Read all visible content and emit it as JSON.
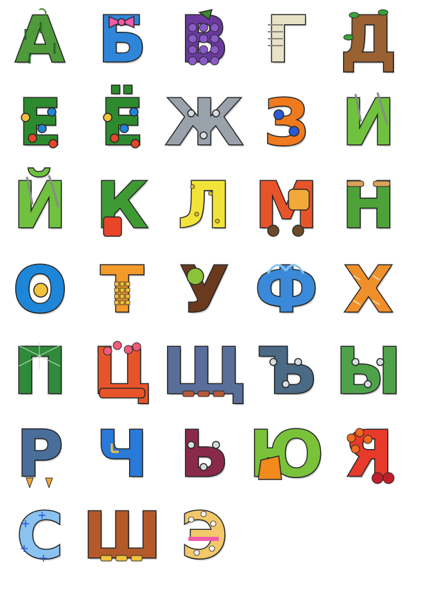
{
  "letters": [
    {
      "char": "А",
      "fill": "#4f9a3a",
      "deco": "melon"
    },
    {
      "char": "Б",
      "fill": "#2f86d9",
      "deco": "bow",
      "accent": "#f25ba7"
    },
    {
      "char": "В",
      "fill": "#6a3a9e",
      "deco": "grapes",
      "accent": "#3a8a2a"
    },
    {
      "char": "Г",
      "fill": "#e8e2c8",
      "deco": "newspaper"
    },
    {
      "char": "Д",
      "fill": "#9a6232",
      "deco": "tree",
      "accent": "#3aa23a"
    },
    {
      "char": "Е",
      "fill": "#2e8a2e",
      "deco": "ornaments"
    },
    {
      "char": "Ё",
      "fill": "#2e8a2e",
      "deco": "ornaments"
    },
    {
      "char": "Ж",
      "fill": "#9aa2ab",
      "deco": "bolts"
    },
    {
      "char": "З",
      "fill": "#f07a1e",
      "deco": "patch",
      "accent": "#2a5ad9"
    },
    {
      "char": "И",
      "fill": "#6fc13f",
      "deco": "needles"
    },
    {
      "char": "Й",
      "fill": "#6fc13f",
      "deco": "needles"
    },
    {
      "char": "К",
      "fill": "#3f9a34",
      "deco": "cactus",
      "accent": "#e8452a"
    },
    {
      "char": "Л",
      "fill": "#f2e33a",
      "deco": "noodle"
    },
    {
      "char": "М",
      "fill": "#e8542a",
      "deco": "truck",
      "accent": "#f2a93a"
    },
    {
      "char": "Н",
      "fill": "#4fa23a",
      "deco": "spools"
    },
    {
      "char": "О",
      "fill": "#1e86d9",
      "deco": "pond",
      "accent": "#f2c23a"
    },
    {
      "char": "Т",
      "fill": "#f29a2a",
      "deco": "phone"
    },
    {
      "char": "У",
      "fill": "#6a3a1e",
      "deco": "snail",
      "accent": "#8ac23a"
    },
    {
      "char": "Ф",
      "fill": "#3a8ad9",
      "deco": "fountain"
    },
    {
      "char": "Х",
      "fill": "#f0902a",
      "deco": "bread"
    },
    {
      "char": "П",
      "fill": "#2f8a3a",
      "deco": "web"
    },
    {
      "char": "Ц",
      "fill": "#e8542a",
      "deco": "flowers",
      "accent": "#8ac23a"
    },
    {
      "char": "Щ",
      "fill": "#5a6e9a",
      "deco": "cabinet",
      "accent": "#b45a3a"
    },
    {
      "char": "Ъ",
      "fill": "#4a6a86",
      "deco": "bolts"
    },
    {
      "char": "Ы",
      "fill": "#4fa24a",
      "deco": "bolts"
    },
    {
      "char": "Р",
      "fill": "#4a6e9a",
      "deco": "rocket",
      "accent": "#f2a93a"
    },
    {
      "char": "Ч",
      "fill": "#2a7ad9",
      "deco": "clock",
      "accent": "#f2c23a"
    },
    {
      "char": "Ь",
      "fill": "#8a2a4a",
      "deco": "bolts"
    },
    {
      "char": "Ю",
      "fill": "#7ac23a",
      "deco": "dress",
      "accent": "#f2c23a"
    },
    {
      "char": "Я",
      "fill": "#e83a2a",
      "deco": "berries",
      "accent": "#f26a1e"
    },
    {
      "char": "С",
      "fill": "#8ac2f0",
      "deco": "snow"
    },
    {
      "char": "Ш",
      "fill": "#b45a2a",
      "deco": "cabinet"
    },
    {
      "char": "Э",
      "fill": "#f2c86a",
      "deco": "donut",
      "accent": "#f25ba7"
    }
  ]
}
